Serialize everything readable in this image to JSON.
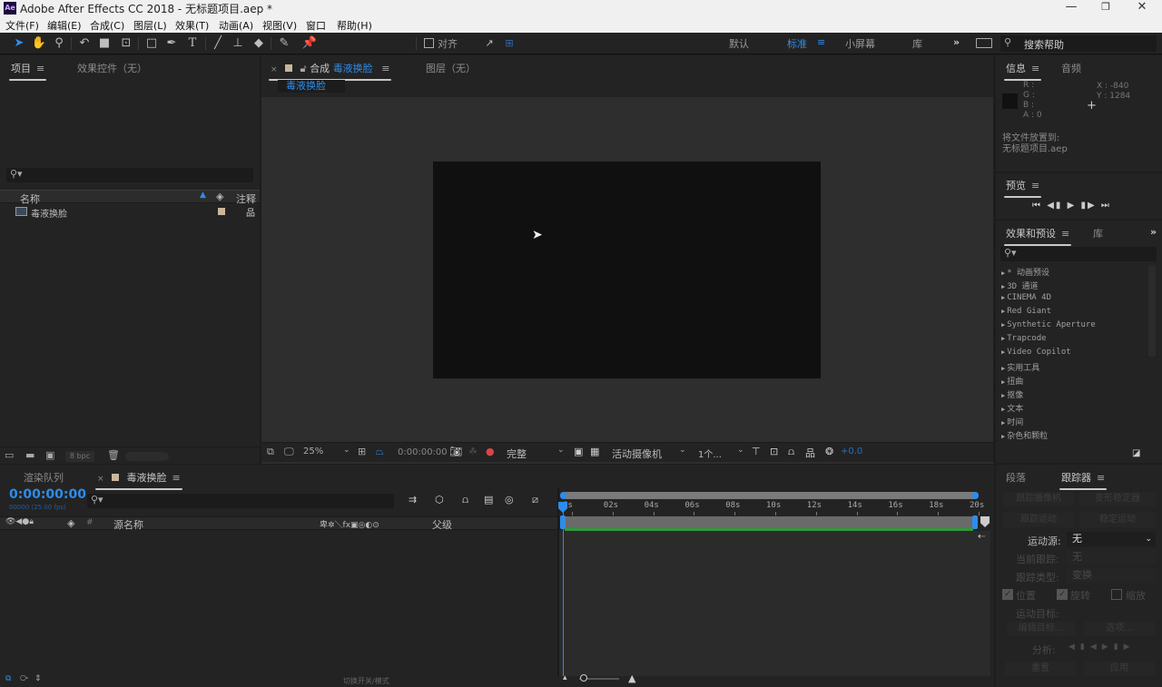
{
  "window": {
    "logo": "Ae",
    "title": "Adobe After Effects CC 2018 - 无标题项目.aep *",
    "controls": {
      "minimize": "—",
      "restore": "❐",
      "close": "✕"
    }
  },
  "menu": [
    "文件(F)",
    "编辑(E)",
    "合成(C)",
    "图层(L)",
    "效果(T)",
    "动画(A)",
    "视图(V)",
    "窗口",
    "帮助(H)"
  ],
  "toolbar": {
    "tools": [
      "selection-tool",
      "hand-tool",
      "zoom-tool",
      "rotation-tool",
      "camera-tool",
      "pan-behind-tool",
      "rectangle-tool",
      "pen-tool",
      "type-tool",
      "brush-tool",
      "clone-stamp-tool",
      "eraser-tool",
      "roto-brush-tool",
      "puppet-pin-tool"
    ],
    "snap_label": "对齐",
    "workspaces": [
      "默认",
      "标准",
      "小屏幕",
      "库"
    ],
    "active_workspace": "标准",
    "more": "»",
    "search_placeholder": "搜索帮助"
  },
  "project_panel": {
    "tabs": [
      "项目",
      "效果控件（无）"
    ],
    "search_placeholder": "",
    "columns": {
      "name": "名称",
      "comment": "注释"
    },
    "items": [
      {
        "name": "毒液换脸",
        "type": "composition",
        "label_color": "#c8b89a"
      }
    ],
    "footer": {
      "bpc": "8 bpc"
    }
  },
  "comp_panel": {
    "tabs": [
      {
        "prefix": "合成",
        "name": "毒液换脸"
      },
      {
        "label": "图层（无）"
      }
    ],
    "breadcrumb": "毒液换脸",
    "footer": {
      "zoom": "25%",
      "timecode": "0:00:00:00",
      "resolution": "完整",
      "camera": "活动摄像机",
      "views": "1个...",
      "exposure": "+0.0"
    }
  },
  "info_panel": {
    "tabs": [
      "信息",
      "音频"
    ],
    "r": "R :",
    "g": "G :",
    "b": "B :",
    "a": "A : 0",
    "x": "X : -840",
    "y": "Y : 1284",
    "message_line1": "将文件放置到:",
    "message_line2": "无标题项目.aep"
  },
  "preview_panel": {
    "title": "预览",
    "controls": [
      "first-frame",
      "prev-frame",
      "play",
      "next-frame",
      "last-frame"
    ]
  },
  "effects_panel": {
    "tabs": [
      "效果和预设",
      "库"
    ],
    "items": [
      "* 动画预设",
      "3D 通道",
      "CINEMA 4D",
      "Red Giant",
      "Synthetic Aperture",
      "Trapcode",
      "Video Copilot",
      "实用工具",
      "扭曲",
      "抠像",
      "文本",
      "时间",
      "杂色和颗粒"
    ]
  },
  "tracker_panel": {
    "tabs": [
      "段落",
      "跟踪器"
    ],
    "buttons_row1": [
      "跟踪摄像机",
      "变形稳定器"
    ],
    "buttons_row2": [
      "跟踪运动",
      "稳定运动"
    ],
    "motion_source_label": "运动源:",
    "motion_source_value": "无",
    "current_track_label": "当前跟踪:",
    "current_track_value": "无",
    "track_type_label": "跟踪类型:",
    "track_type_value": "变换",
    "checkboxes": [
      {
        "label": "位置",
        "checked": true
      },
      {
        "label": "旋转",
        "checked": true
      },
      {
        "label": "缩放",
        "checked": false
      }
    ],
    "motion_target_label": "运动目标:",
    "edit_target": "编辑目标...",
    "options": "选项...",
    "analyze_label": "分析:",
    "reset": "重置",
    "apply": "应用"
  },
  "timeline": {
    "tabs": [
      "渲染队列",
      "毒液换脸"
    ],
    "timecode": "0:00:00:00",
    "frame_info": "00000 (25.00 fps)",
    "columns": {
      "source_name": "源名称",
      "parent": "父级",
      "number": "#"
    },
    "ruler": [
      "0s",
      "02s",
      "04s",
      "06s",
      "08s",
      "10s",
      "12s",
      "14s",
      "16s",
      "18s",
      "20s"
    ],
    "footer_toggle": "切换开关/模式"
  }
}
